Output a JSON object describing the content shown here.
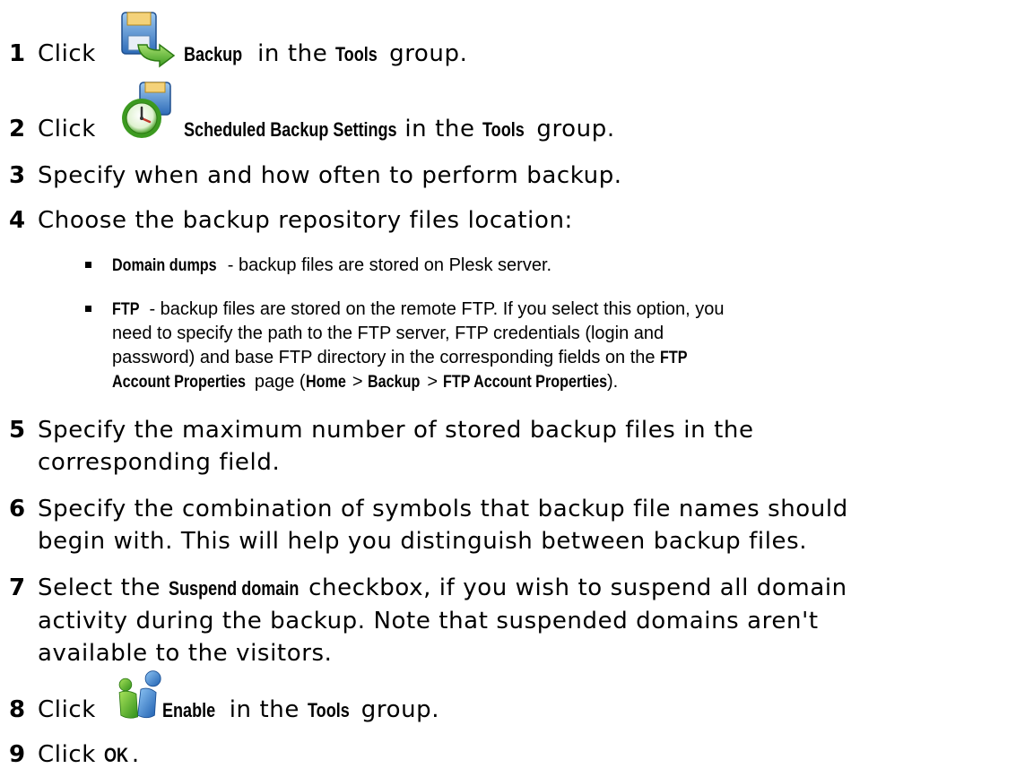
{
  "steps": [
    {
      "num": "1",
      "parts": [
        "Click",
        "Backup",
        "in the",
        "Tools",
        "group."
      ],
      "icon": "backup-icon"
    },
    {
      "num": "2",
      "parts": [
        "Click",
        "Scheduled Backup Settings",
        "in the",
        "Tools",
        "group."
      ],
      "icon": "scheduled-backup-icon"
    },
    {
      "num": "3",
      "text": "Specify when and how often to perform backup."
    },
    {
      "num": "4",
      "text": "Choose the backup repository files location:"
    },
    {
      "num": "5",
      "text_line1": "Specify the maximum number of stored backup files in the",
      "text_line2": "corresponding field."
    },
    {
      "num": "6",
      "text_line1": "Specify the combination of symbols that backup file names should",
      "text_line2": "begin with. This will help you distinguish between backup files."
    },
    {
      "num": "7",
      "parts": [
        "Select the",
        "Suspend domain",
        "checkbox, if you wish to suspend all domain"
      ],
      "text_line2": "activity during the backup. Note that suspended domains aren't",
      "text_line3": "available to the visitors."
    },
    {
      "num": "8",
      "parts": [
        "Click",
        "Enable",
        "in the",
        "Tools",
        "group."
      ],
      "icon": "enable-icon"
    },
    {
      "num": "9",
      "parts": [
        "Click",
        "OK",
        "."
      ]
    }
  ],
  "options": [
    {
      "label": "Domain dumps",
      "desc": "- backup files are stored on Plesk server."
    },
    {
      "label": "FTP",
      "desc_line1": "- backup files are stored on the remote FTP.  If you select this option, you",
      "desc_line2": "need to specify the path to the FTP server, FTP credentials (login and",
      "desc_line3": "password) and base FTP directory in the corresponding fields on the",
      "ftp_props_a": "FTP",
      "ftp_props_b": "Account Properties",
      "page_open": "page (",
      "path_home": "Home",
      "sep1": ">",
      "path_backup": "Backup",
      "sep2": ">",
      "path_ftp": "FTP Account Properties",
      "page_close": ")."
    }
  ]
}
